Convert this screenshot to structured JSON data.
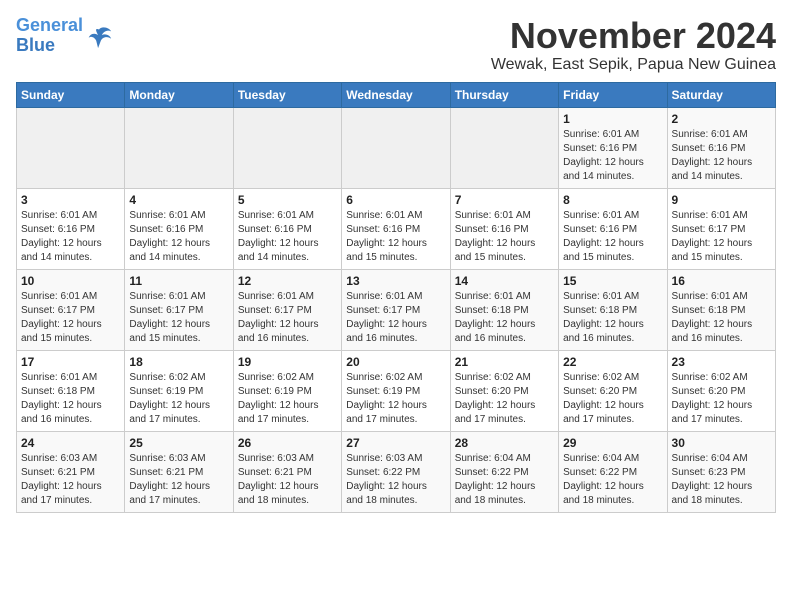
{
  "logo": {
    "text1": "General",
    "text2": "Blue"
  },
  "title": "November 2024",
  "subtitle": "Wewak, East Sepik, Papua New Guinea",
  "days_of_week": [
    "Sunday",
    "Monday",
    "Tuesday",
    "Wednesday",
    "Thursday",
    "Friday",
    "Saturday"
  ],
  "weeks": [
    [
      {
        "day": "",
        "info": ""
      },
      {
        "day": "",
        "info": ""
      },
      {
        "day": "",
        "info": ""
      },
      {
        "day": "",
        "info": ""
      },
      {
        "day": "",
        "info": ""
      },
      {
        "day": "1",
        "info": "Sunrise: 6:01 AM\nSunset: 6:16 PM\nDaylight: 12 hours and 14 minutes."
      },
      {
        "day": "2",
        "info": "Sunrise: 6:01 AM\nSunset: 6:16 PM\nDaylight: 12 hours and 14 minutes."
      }
    ],
    [
      {
        "day": "3",
        "info": "Sunrise: 6:01 AM\nSunset: 6:16 PM\nDaylight: 12 hours and 14 minutes."
      },
      {
        "day": "4",
        "info": "Sunrise: 6:01 AM\nSunset: 6:16 PM\nDaylight: 12 hours and 14 minutes."
      },
      {
        "day": "5",
        "info": "Sunrise: 6:01 AM\nSunset: 6:16 PM\nDaylight: 12 hours and 14 minutes."
      },
      {
        "day": "6",
        "info": "Sunrise: 6:01 AM\nSunset: 6:16 PM\nDaylight: 12 hours and 15 minutes."
      },
      {
        "day": "7",
        "info": "Sunrise: 6:01 AM\nSunset: 6:16 PM\nDaylight: 12 hours and 15 minutes."
      },
      {
        "day": "8",
        "info": "Sunrise: 6:01 AM\nSunset: 6:16 PM\nDaylight: 12 hours and 15 minutes."
      },
      {
        "day": "9",
        "info": "Sunrise: 6:01 AM\nSunset: 6:17 PM\nDaylight: 12 hours and 15 minutes."
      }
    ],
    [
      {
        "day": "10",
        "info": "Sunrise: 6:01 AM\nSunset: 6:17 PM\nDaylight: 12 hours and 15 minutes."
      },
      {
        "day": "11",
        "info": "Sunrise: 6:01 AM\nSunset: 6:17 PM\nDaylight: 12 hours and 15 minutes."
      },
      {
        "day": "12",
        "info": "Sunrise: 6:01 AM\nSunset: 6:17 PM\nDaylight: 12 hours and 16 minutes."
      },
      {
        "day": "13",
        "info": "Sunrise: 6:01 AM\nSunset: 6:17 PM\nDaylight: 12 hours and 16 minutes."
      },
      {
        "day": "14",
        "info": "Sunrise: 6:01 AM\nSunset: 6:18 PM\nDaylight: 12 hours and 16 minutes."
      },
      {
        "day": "15",
        "info": "Sunrise: 6:01 AM\nSunset: 6:18 PM\nDaylight: 12 hours and 16 minutes."
      },
      {
        "day": "16",
        "info": "Sunrise: 6:01 AM\nSunset: 6:18 PM\nDaylight: 12 hours and 16 minutes."
      }
    ],
    [
      {
        "day": "17",
        "info": "Sunrise: 6:01 AM\nSunset: 6:18 PM\nDaylight: 12 hours and 16 minutes."
      },
      {
        "day": "18",
        "info": "Sunrise: 6:02 AM\nSunset: 6:19 PM\nDaylight: 12 hours and 17 minutes."
      },
      {
        "day": "19",
        "info": "Sunrise: 6:02 AM\nSunset: 6:19 PM\nDaylight: 12 hours and 17 minutes."
      },
      {
        "day": "20",
        "info": "Sunrise: 6:02 AM\nSunset: 6:19 PM\nDaylight: 12 hours and 17 minutes."
      },
      {
        "day": "21",
        "info": "Sunrise: 6:02 AM\nSunset: 6:20 PM\nDaylight: 12 hours and 17 minutes."
      },
      {
        "day": "22",
        "info": "Sunrise: 6:02 AM\nSunset: 6:20 PM\nDaylight: 12 hours and 17 minutes."
      },
      {
        "day": "23",
        "info": "Sunrise: 6:02 AM\nSunset: 6:20 PM\nDaylight: 12 hours and 17 minutes."
      }
    ],
    [
      {
        "day": "24",
        "info": "Sunrise: 6:03 AM\nSunset: 6:21 PM\nDaylight: 12 hours and 17 minutes."
      },
      {
        "day": "25",
        "info": "Sunrise: 6:03 AM\nSunset: 6:21 PM\nDaylight: 12 hours and 17 minutes."
      },
      {
        "day": "26",
        "info": "Sunrise: 6:03 AM\nSunset: 6:21 PM\nDaylight: 12 hours and 18 minutes."
      },
      {
        "day": "27",
        "info": "Sunrise: 6:03 AM\nSunset: 6:22 PM\nDaylight: 12 hours and 18 minutes."
      },
      {
        "day": "28",
        "info": "Sunrise: 6:04 AM\nSunset: 6:22 PM\nDaylight: 12 hours and 18 minutes."
      },
      {
        "day": "29",
        "info": "Sunrise: 6:04 AM\nSunset: 6:22 PM\nDaylight: 12 hours and 18 minutes."
      },
      {
        "day": "30",
        "info": "Sunrise: 6:04 AM\nSunset: 6:23 PM\nDaylight: 12 hours and 18 minutes."
      }
    ]
  ]
}
